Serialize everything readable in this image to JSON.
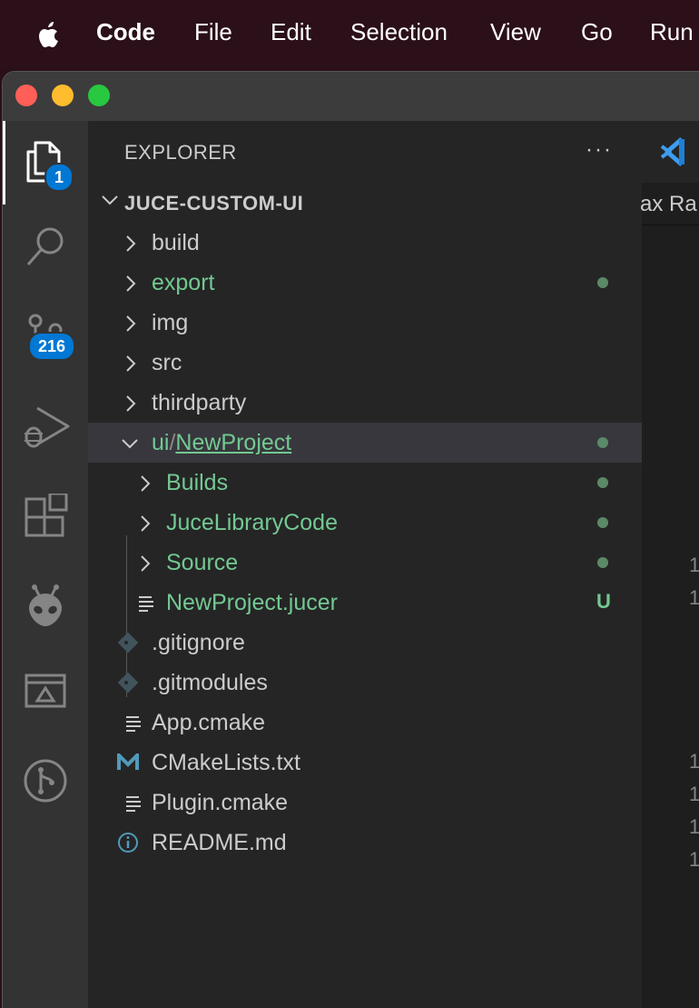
{
  "menubar": {
    "app_name": "Code",
    "items": [
      "File",
      "Edit",
      "Selection",
      "View",
      "Go",
      "Run"
    ]
  },
  "activity_bar": {
    "explorer_badge": "1",
    "source_control_badge": "216"
  },
  "explorer": {
    "title": "EXPLORER",
    "more_actions": "···",
    "root": "JUCE-CUSTOM-UI",
    "tree": [
      {
        "label": "build",
        "type": "folder",
        "modified": false
      },
      {
        "label": "export",
        "type": "folder",
        "modified": true
      },
      {
        "label": "img",
        "type": "folder",
        "modified": false
      },
      {
        "label": "src",
        "type": "folder",
        "modified": false
      },
      {
        "label": "thirdparty",
        "type": "folder",
        "modified": false
      },
      {
        "label_prefix": "ui",
        "separator": "/",
        "label_suffix": "NewProject",
        "type": "folder-open",
        "modified": true
      },
      {
        "label": "Builds",
        "type": "folder",
        "modified": true
      },
      {
        "label": "JuceLibraryCode",
        "type": "folder",
        "modified": true
      },
      {
        "label": "Source",
        "type": "folder",
        "modified": true
      },
      {
        "label": "NewProject.jucer",
        "type": "file",
        "status": "U"
      },
      {
        "label": ".gitignore",
        "type": "git"
      },
      {
        "label": ".gitmodules",
        "type": "git"
      },
      {
        "label": "App.cmake",
        "type": "file"
      },
      {
        "label": "CMakeLists.txt",
        "type": "cmake"
      },
      {
        "label": "Plugin.cmake",
        "type": "file"
      },
      {
        "label": "README.md",
        "type": "info"
      }
    ]
  },
  "editor": {
    "breadcrumb_fragment": "ax Ra",
    "line_numbers": [
      "1",
      "1",
      "1",
      "1",
      "1",
      "1"
    ]
  },
  "colors": {
    "modified_green": "#73c991",
    "badge_blue": "#0078d4",
    "vscode_blue": "#3e9cf0"
  }
}
